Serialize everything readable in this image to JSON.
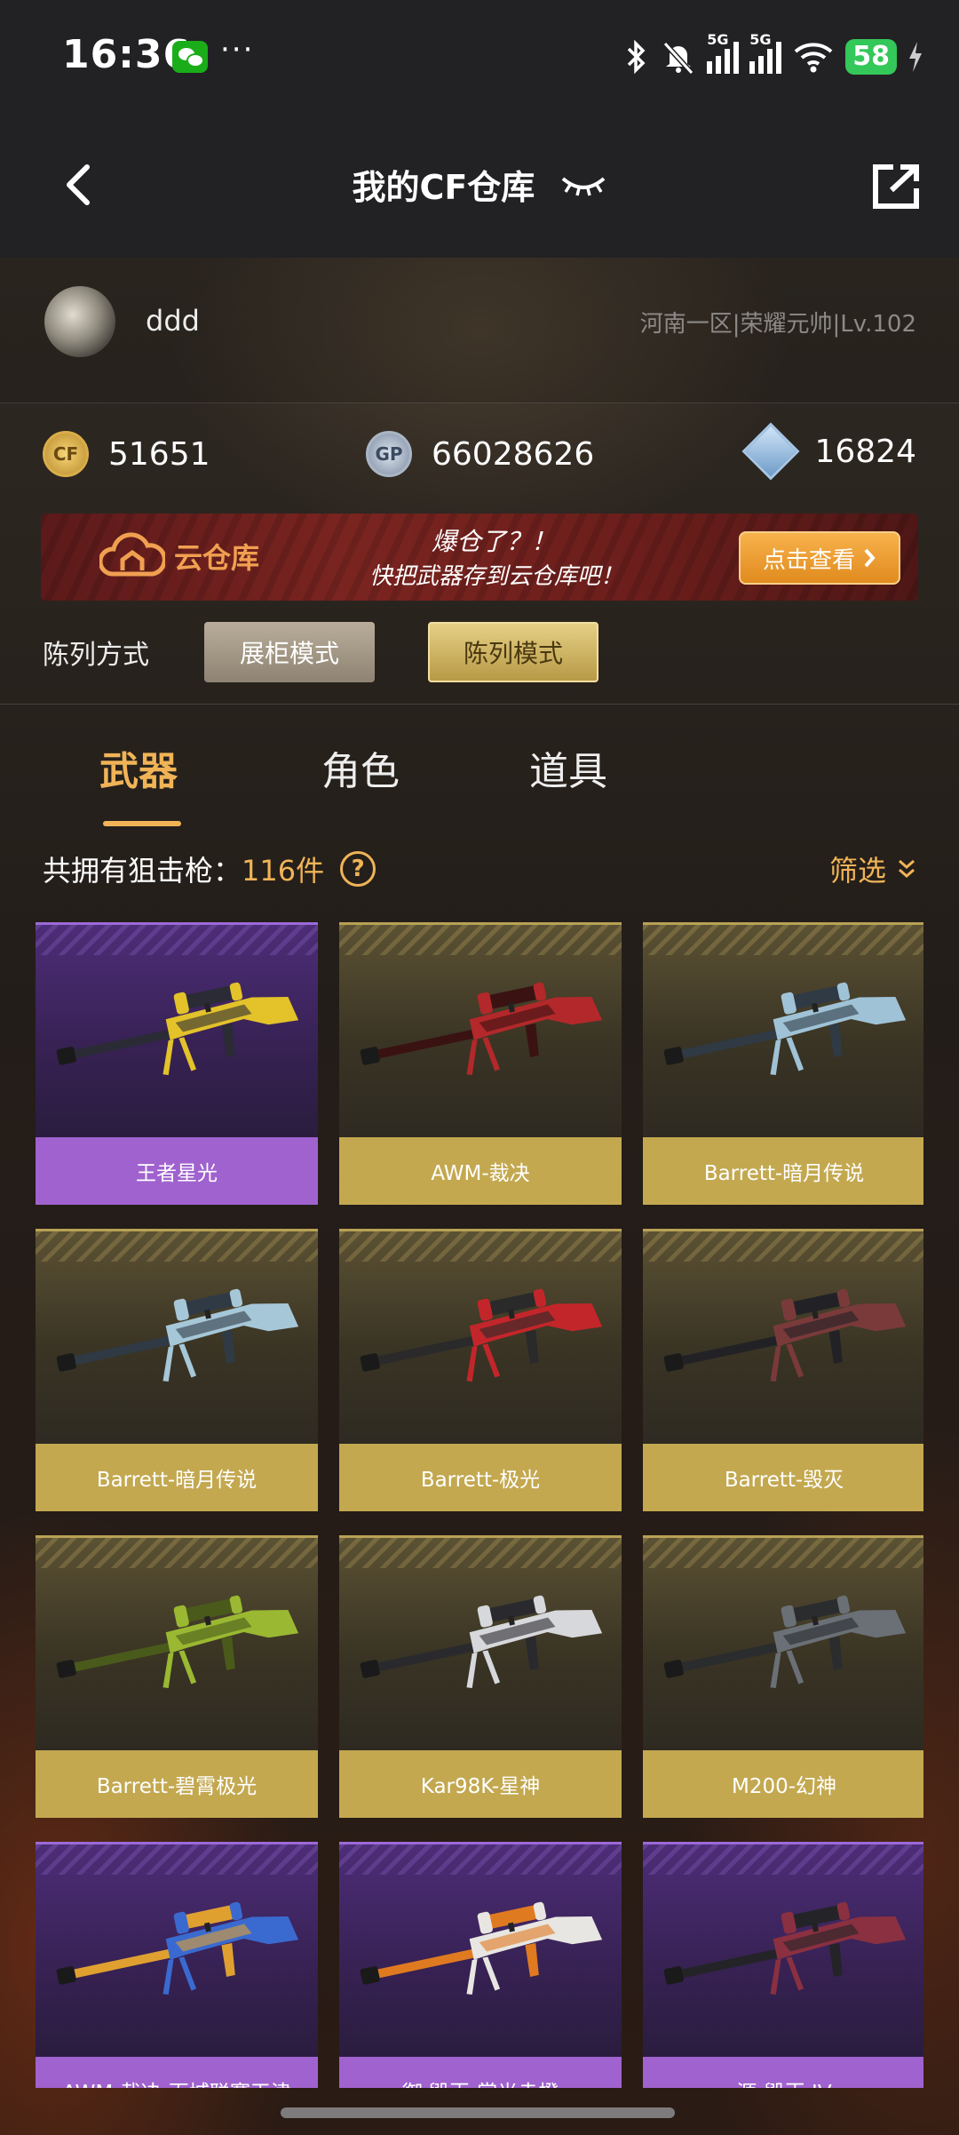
{
  "status_bar": {
    "time": "16:36",
    "more": "···",
    "signal1_label": "5G",
    "signal2_label": "5G",
    "battery": "58"
  },
  "nav": {
    "title": "我的CF仓库"
  },
  "profile": {
    "username": "ddd",
    "server_rank": "河南一区|荣耀元帅|Lv.102"
  },
  "currency": {
    "cf_icon_text": "CF",
    "cf_points": "51651",
    "gp_icon_text": "GP",
    "gp_points": "66028626",
    "diamonds": "16824"
  },
  "banner": {
    "cloud_label": "云仓库",
    "headline": "爆仓了？！",
    "subline": "快把武器存到云仓库吧！",
    "button_label": "点击查看"
  },
  "display_mode": {
    "label": "陈列方式",
    "showcase": "展柜模式",
    "list": "陈列模式"
  },
  "tabs": [
    {
      "label": "武器",
      "active": true
    },
    {
      "label": "角色",
      "active": false
    },
    {
      "label": "道具",
      "active": false
    }
  ],
  "summary": {
    "prefix": "共拥有狙击枪：",
    "count": "116件",
    "help": "?",
    "filter": "筛选"
  },
  "weapons": [
    {
      "name": "王者星光",
      "rarity": "purple",
      "colors": [
        "#e3c22a",
        "#2b2b36"
      ]
    },
    {
      "name": "AWM-裁决",
      "rarity": "gold",
      "colors": [
        "#b3282a",
        "#3a1212"
      ]
    },
    {
      "name": "Barrett-暗月传说",
      "rarity": "gold",
      "colors": [
        "#9fc2d6",
        "#2f3a44"
      ]
    },
    {
      "name": "Barrett-暗月传说",
      "rarity": "gold",
      "colors": [
        "#a6c7d8",
        "#2f3a44"
      ]
    },
    {
      "name": "Barrett-极光",
      "rarity": "gold",
      "colors": [
        "#c3262a",
        "#2a2a2a"
      ]
    },
    {
      "name": "Barrett-毁灭",
      "rarity": "gold",
      "colors": [
        "#7a3a3a",
        "#222226"
      ]
    },
    {
      "name": "Barrett-碧霄极光",
      "rarity": "gold",
      "colors": [
        "#9ab832",
        "#4a5a1a"
      ]
    },
    {
      "name": "Kar98K-星神",
      "rarity": "gold",
      "colors": [
        "#d6d8dc",
        "#2a2a2e"
      ]
    },
    {
      "name": "M200-幻神",
      "rarity": "gold",
      "colors": [
        "#6a7076",
        "#2a2c2e"
      ]
    },
    {
      "name": "AWM-裁决-百城联赛天津",
      "rarity": "purple",
      "colors": [
        "#3a6ad0",
        "#e0a030"
      ]
    },
    {
      "name": "御·毁灭-赏光赤橙",
      "rarity": "purple",
      "colors": [
        "#e8e6e2",
        "#e07a20"
      ]
    },
    {
      "name": "源-毁灭 IV",
      "rarity": "purple",
      "colors": [
        "#8a3040",
        "#242428"
      ]
    }
  ]
}
